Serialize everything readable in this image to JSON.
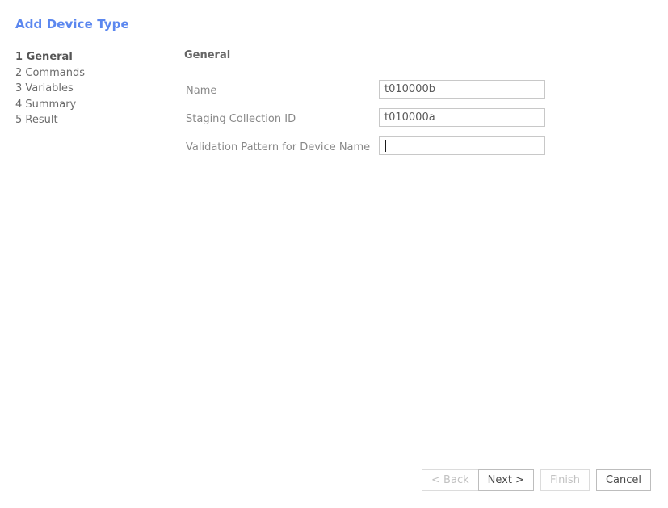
{
  "wizard": {
    "title": "Add Device Type"
  },
  "steps": [
    {
      "label": "1 General",
      "active": true
    },
    {
      "label": "2 Commands",
      "active": false
    },
    {
      "label": "3 Variables",
      "active": false
    },
    {
      "label": "4 Summary",
      "active": false
    },
    {
      "label": "5 Result",
      "active": false
    }
  ],
  "panel": {
    "heading": "General",
    "fields": [
      {
        "label": "Name",
        "value": "t010000b",
        "placeholder": "",
        "focused": false
      },
      {
        "label": "Staging Collection ID",
        "value": "t010000a",
        "placeholder": "",
        "focused": false
      },
      {
        "label": "Validation Pattern for Device Name",
        "value": "",
        "placeholder": "",
        "focused": true
      }
    ]
  },
  "buttons": {
    "back": {
      "label": "< Back",
      "enabled": false
    },
    "next": {
      "label": "Next >",
      "enabled": true
    },
    "finish": {
      "label": "Finish",
      "enabled": false
    },
    "cancel": {
      "label": "Cancel",
      "enabled": true
    }
  },
  "colors": {
    "title": "#5b87ef",
    "label": "#888888",
    "heading": "#666666",
    "input_border": "#c8c8c8",
    "button_border": "#bdbdbd",
    "button_border_disabled": "#dcdcdc",
    "button_text": "#4a4a4a",
    "button_text_disabled": "#c2c2c2",
    "background": "#ffffff"
  }
}
